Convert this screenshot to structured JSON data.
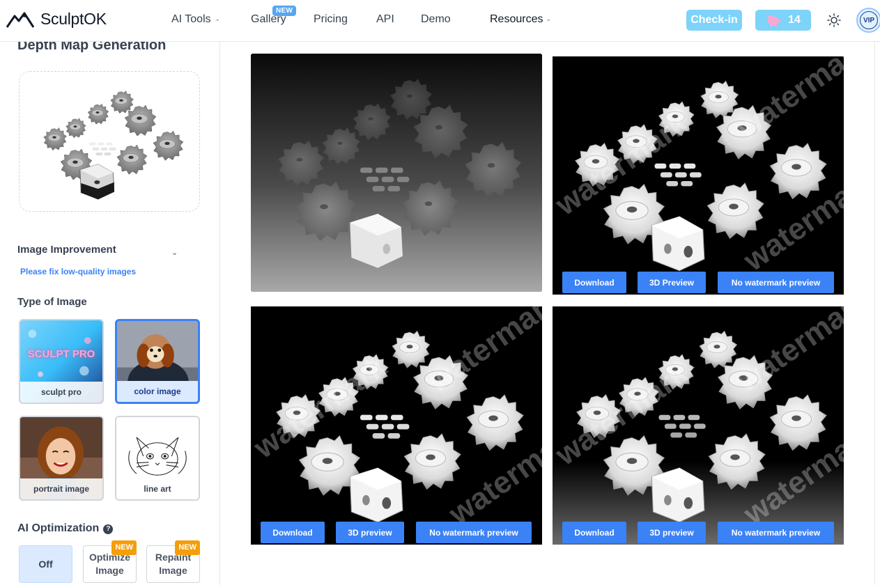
{
  "brand": {
    "name": "SculptOK",
    "logo_icon": "mountain-logo-icon"
  },
  "nav": {
    "ai_tools": "AI Tools",
    "gallery": "Gallery",
    "gallery_badge": "NEW",
    "pricing": "Pricing",
    "api": "API",
    "demo": "Demo",
    "resources": "Resources"
  },
  "header_actions": {
    "checkin": "Check-in",
    "coins": "14",
    "coin_icon": "piggy-bank-icon",
    "theme_icon": "sun-icon",
    "vip": "VIP"
  },
  "sidebar": {
    "title": "Depth Map Generation",
    "image_improvement": {
      "heading": "Image Improvement",
      "link": "Please fix low-quality images"
    },
    "type_heading": "Type of Image",
    "types": [
      {
        "label": "sculpt pro",
        "art_text": "SCULPT PRO",
        "selected": false
      },
      {
        "label": "color image",
        "selected": true
      },
      {
        "label": "portrait image",
        "selected": false
      },
      {
        "label": "line art",
        "selected": false
      }
    ],
    "ai_opt": {
      "heading": "AI Optimization",
      "off": "Off",
      "optimize_l1": "Optimize",
      "optimize_l2": "Image",
      "repaint_l1": "Repaint",
      "repaint_l2": "Image",
      "badge": "NEW"
    }
  },
  "results": {
    "watermark": "watermark",
    "card2": {
      "download": "Download",
      "preview": "3D Preview",
      "nowm": "No watermark preview"
    },
    "card3": {
      "download": "Download",
      "preview": "3D preview",
      "nowm": "No watermark preview"
    },
    "card4": {
      "download": "Download",
      "preview": "3D preview",
      "nowm": "No watermark preview"
    }
  },
  "colors": {
    "accent": "#3b82f6",
    "checkin": "#7dd3f9",
    "badge_orange": "#f59e0b",
    "badge_blue": "#55a6f3"
  }
}
